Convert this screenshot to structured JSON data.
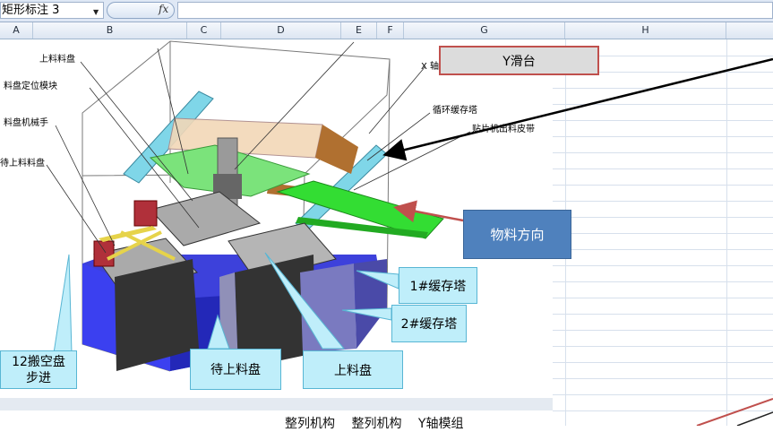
{
  "toolbar": {
    "name_box": "矩形标注 3",
    "fx_label": "fx"
  },
  "columns": [
    "A",
    "B",
    "C",
    "D",
    "E",
    "F",
    "G",
    "H"
  ],
  "diagram_labels": {
    "top_tray": "上料料盘",
    "tray_locator": "料盘定位模块",
    "tray_manipulator": "料盘机械手",
    "waiting_tray": "待上料料盘",
    "x_axis": "X 轴",
    "cycle_buffer": "循环缓存塔",
    "output_belt": "贴片机出料皮带"
  },
  "callouts": {
    "y_slide": "Y滑台",
    "material_direction": "物料方向",
    "buffer1": "1#缓存塔",
    "buffer2": "2#缓存塔",
    "empty_tray": "12搬空盘步进",
    "waiting_tray": "待上料盘",
    "loading_tray": "上料盘"
  },
  "bottom_row_text": "整列机构 整列机构 Y轴模组",
  "colors": {
    "ribbon": "#dfe8f5",
    "callout_cyan": "#bfeefa",
    "callout_blue": "#4f81bd",
    "callout_border_red": "#c0504d",
    "machine_blue": "#2d31d8",
    "belt_green": "#33dd33"
  }
}
